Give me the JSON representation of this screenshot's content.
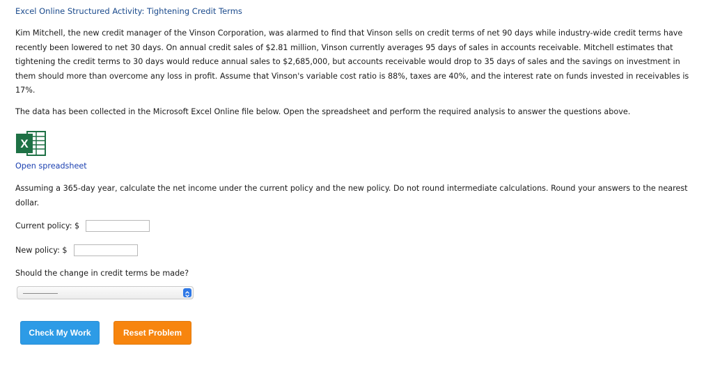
{
  "activity_title": "Excel Online Structured Activity: Tightening Credit Terms",
  "problem_text": "Kim Mitchell, the new credit manager of the Vinson Corporation, was alarmed to find that Vinson sells on credit terms of net 90 days while industry-wide credit terms have recently been lowered to net 30 days. On annual credit sales of $2.81 million, Vinson currently averages 95 days of sales in accounts receivable. Mitchell estimates that tightening the credit terms to 30 days would reduce annual sales to $2,685,000, but accounts receivable would drop to 35 days of sales and the savings on investment in them should more than overcome any loss in profit. Assume that Vinson's variable cost ratio is 88%, taxes are 40%, and the interest rate on funds invested in receivables is 17%.",
  "instruction_text": "The data has been collected in the Microsoft Excel Online file below. Open the spreadsheet and perform the required analysis to answer the questions above.",
  "excel_icon_letter": "X",
  "open_spreadsheet_label": "Open spreadsheet",
  "question_text": "Assuming a 365-day year, calculate the net income under the current policy and the new policy. Do not round intermediate calculations. Round your answers to the nearest dollar.",
  "current_policy": {
    "label": "Current policy: $",
    "value": ""
  },
  "new_policy": {
    "label": "New policy: $",
    "value": ""
  },
  "change_question": "Should the change in credit terms be made?",
  "change_select": {
    "selected": ""
  },
  "buttons": {
    "check": "Check My Work",
    "reset": "Reset Problem"
  },
  "colors": {
    "title_blue": "#1a4a8c",
    "link_blue": "#1a3fb0",
    "excel_green": "#1e7145",
    "check_button": "#2d9be6",
    "reset_button": "#f7850e"
  }
}
